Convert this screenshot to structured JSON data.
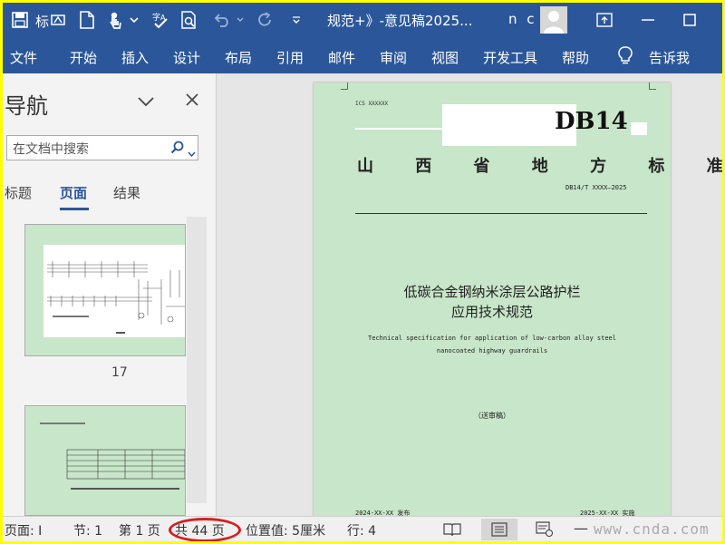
{
  "titlebar": {
    "app_label": "标",
    "doc_title": "规范+》-意见稿2025...",
    "user_name": "n c",
    "qat_icons": [
      "save-icon",
      "new-document-icon",
      "touch-mode-icon",
      "dropdown-icon",
      "spelling-icon",
      "print-preview-icon",
      "undo-icon",
      "redo-icon",
      "customize-qat-icon"
    ],
    "accent": "#2b579a"
  },
  "ribbon": {
    "tabs": [
      "文件",
      "开始",
      "插入",
      "设计",
      "布局",
      "引用",
      "邮件",
      "审阅",
      "视图",
      "开发工具",
      "帮助"
    ],
    "tell_me": "告诉我"
  },
  "nav": {
    "title": "导航",
    "search_placeholder": "在文档中搜索",
    "tabs": [
      "标题",
      "页面",
      "结果"
    ],
    "thumb_page_number": "17"
  },
  "document": {
    "ics": "ICS XXXXXX",
    "db": "DB14",
    "province_standard": "山 西 省 地 方 标 准",
    "standard_number": "DB14/T XXXX—2025",
    "title_cn_line1": "低碳合金钢纳米涂层公路护栏",
    "title_cn_line2": "应用技术规范",
    "title_en_line1": "Technical specification for application of low-carbon alloy steel",
    "title_en_line2": "nanocoated highway guardrails",
    "draft_note": "（送审稿）",
    "publish_date": "2024-XX-XX 发布",
    "implement_date": "2025-XX-XX 实施",
    "page_color": "#c8e6c9"
  },
  "status": {
    "page": "页面: I",
    "section": "节: 1",
    "page_of": "第 1 页",
    "total": "共 44 页",
    "position": "位置值: 5厘米",
    "line": "行: 4",
    "zoom_minus": "—",
    "watermark": "www.cnda.com"
  }
}
